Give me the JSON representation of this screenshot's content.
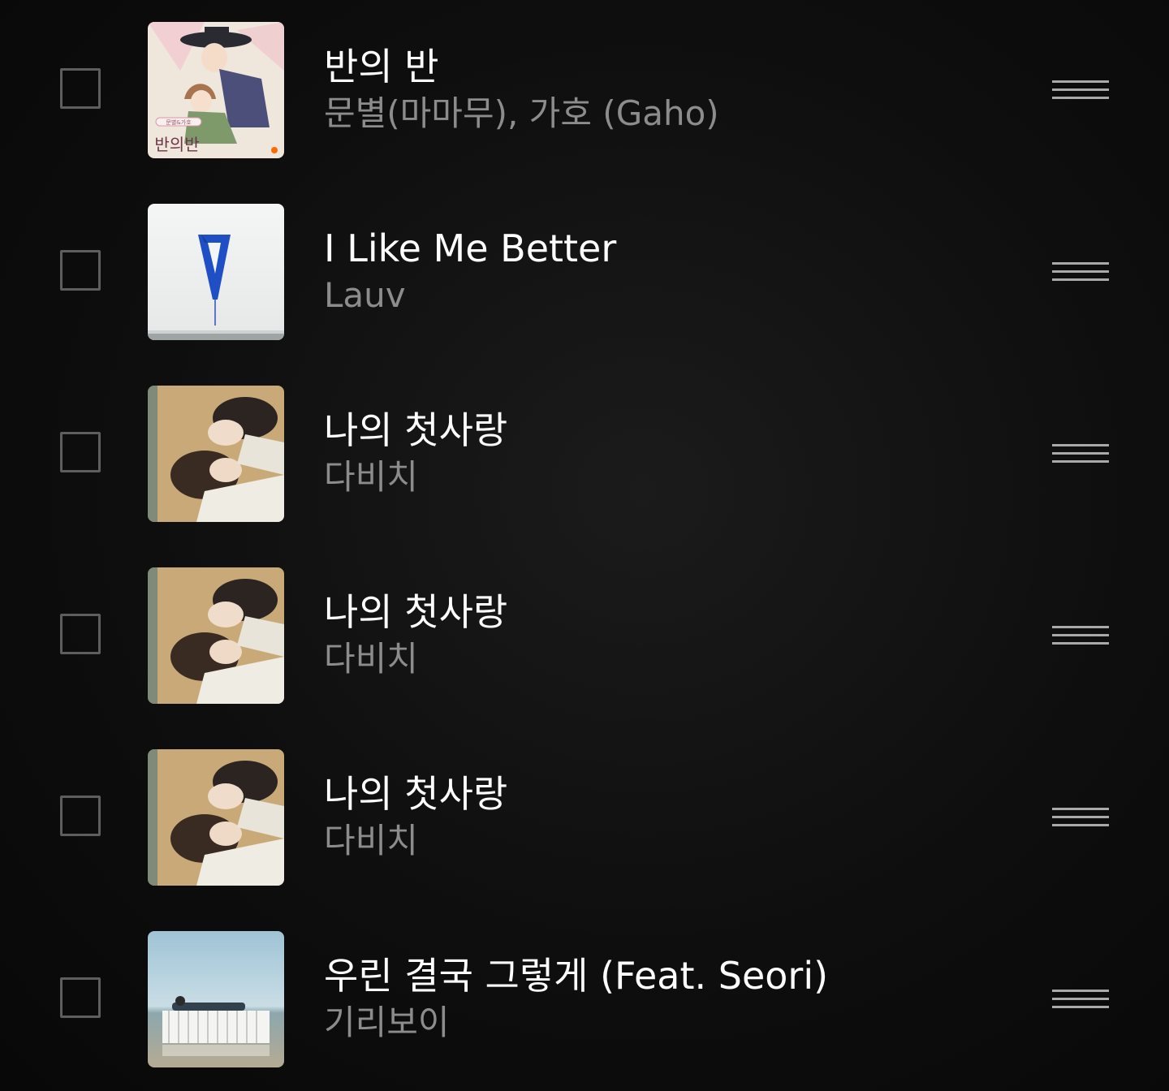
{
  "tracks": [
    {
      "title": "반의 반",
      "artist": "문별(마마무), 가호 (Gaho)",
      "art": "illustrated-couple-cover",
      "art_text": "반의반"
    },
    {
      "title": "I Like Me Better",
      "artist": "Lauv",
      "art": "blue-v-on-white-cover"
    },
    {
      "title": "나의 첫사랑",
      "artist": "다비치",
      "art": "two-women-lying-cover"
    },
    {
      "title": "나의 첫사랑",
      "artist": "다비치",
      "art": "two-women-lying-cover"
    },
    {
      "title": "나의 첫사랑",
      "artist": "다비치",
      "art": "two-women-lying-cover"
    },
    {
      "title": "우린 결국 그렇게 (Feat. Seori)",
      "artist": "기리보이",
      "art": "white-fence-by-sea-cover"
    }
  ],
  "colors": {
    "background": "#0b0b0b",
    "title": "#ffffff",
    "artist": "#8c8c8c",
    "checkbox_border": "#5e5e5e",
    "drag_handle": "#a9a9a9"
  }
}
